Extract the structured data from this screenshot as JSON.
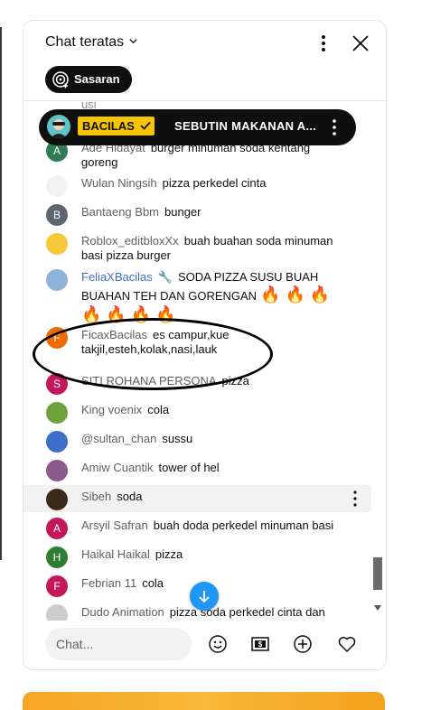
{
  "header": {
    "title": "Chat teratas"
  },
  "goal_button": {
    "label": "Sasaran"
  },
  "pinned": {
    "badge": "BACILAS",
    "text": "SEBUTIN MAKANAN A..."
  },
  "partial_top": "usi",
  "messages": [
    {
      "author": "Ade Hidayat",
      "text": "burger minuman soda kentang goreng",
      "initial": "A",
      "color": "#2e7d55"
    },
    {
      "author": "Wulan Ningsih",
      "text": "pizza perkedel cinta",
      "initial": "",
      "color": "#f2f2f2"
    },
    {
      "author": "Bantaeng Bbm",
      "text": "bunger",
      "initial": "B",
      "color": "#5d6670"
    },
    {
      "author": "Roblox_editbloxXx",
      "text": "buah buahan soda minuman basi pizza burger",
      "initial": "",
      "color": "#f7c83a"
    },
    {
      "author": "FeliaXBacilas",
      "text": "SODA PIZZA SUSU BUAH BUAHAN TEH DAN GORENGAN",
      "emoji": "🔥 🔥 🔥 🔥 🔥 🔥 🔥",
      "initial": "",
      "color": "#8fb3d8"
    },
    {
      "author": "FicaxBacilas",
      "text": "es campur,kue takjil,esteh,kolak,nasi,lauk",
      "initial": "F",
      "color": "#ef6c00"
    },
    {
      "author": "SITI ROHANA PERSONA",
      "text": "pizza",
      "initial": "S",
      "color": "#c2185b"
    },
    {
      "author": "King voenix",
      "text": "cola",
      "initial": "",
      "color": "#6ea23f"
    },
    {
      "author": "@sultan_chan",
      "text": "sussu",
      "initial": "",
      "color": "#3d6fc8"
    },
    {
      "author": "Amiw Cuantik",
      "text": "tower of hel",
      "initial": "",
      "color": "#8b5a8c"
    },
    {
      "author": "Sibeh",
      "text": "soda",
      "initial": "",
      "color": "#3b2a1a"
    },
    {
      "author": "Arsyil Safran",
      "text": "buah doda perkedel minuman basi",
      "initial": "A",
      "color": "#c2185b"
    },
    {
      "author": "Haikal Haikal",
      "text": "pizza",
      "initial": "H",
      "color": "#2e7d32"
    },
    {
      "author": "Febrian 11",
      "text": "cola",
      "initial": "F",
      "color": "#c2185b"
    },
    {
      "author": "Dudo Animation",
      "text": "pizza soda perkedel cinta dan",
      "initial": "",
      "color": "#cccccc"
    }
  ],
  "input": {
    "placeholder": "Chat..."
  },
  "icons": {
    "chevron": "chevron-down-icon",
    "more": "more-vert-icon",
    "close": "close-icon",
    "goal": "target-icon",
    "scroll": "arrow-down-icon",
    "emoji": "emoji-icon",
    "super_chat": "dollar-icon",
    "add": "add-icon",
    "like": "heart-icon"
  },
  "colors": {
    "badge": "#f7c400",
    "fab": "#2196f3",
    "pinned_bg": "#0f0f0f",
    "banner": "#f6a623"
  }
}
